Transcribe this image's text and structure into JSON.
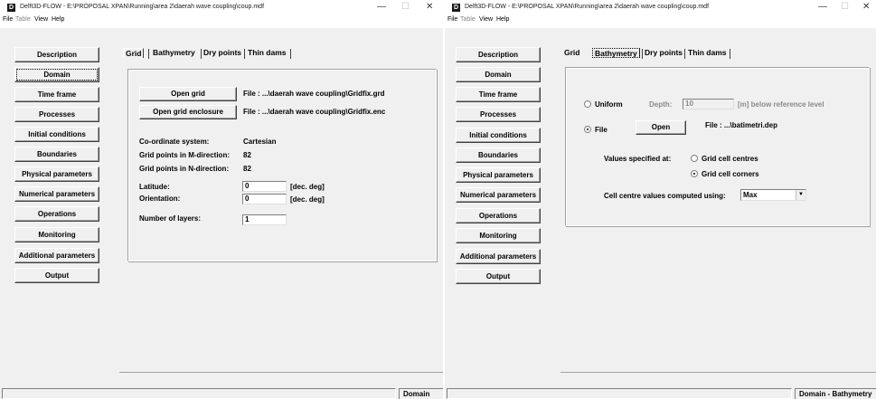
{
  "left": {
    "title": "Delft3D-FLOW - E:\\PROPOSAL XPAN\\Running\\area 2\\daerah wave coupling\\coup.mdf",
    "menu": [
      "File",
      "Table",
      "View",
      "Help"
    ],
    "nav": [
      "Description",
      "Domain",
      "Time frame",
      "Processes",
      "Initial conditions",
      "Boundaries",
      "Physical parameters",
      "Numerical parameters",
      "Operations",
      "Monitoring",
      "Additional parameters",
      "Output"
    ],
    "tabs": [
      "Grid",
      "Bathymetry",
      "Dry points",
      "Thin dams"
    ],
    "open_grid_label": "Open grid",
    "grid_file_text": "File : ...\\daerah wave coupling\\Gridfix.grd",
    "open_enclosure_label": "Open grid enclosure",
    "enclosure_file_text": "File : ...\\daerah wave coupling\\Gridfix.enc",
    "coord_label": "Co-ordinate system:",
    "coord_value": "Cartesian",
    "m_label": "Grid points in M-direction:",
    "m_value": "82",
    "n_label": "Grid points in N-direction:",
    "n_value": "82",
    "latitude_label": "Latitude:",
    "latitude_value": "0",
    "latitude_unit": "[dec. deg]",
    "orientation_label": "Orientation:",
    "orientation_value": "0",
    "orientation_unit": "[dec. deg]",
    "layers_label": "Number of layers:",
    "layers_value": "1",
    "status": "Domain"
  },
  "right": {
    "title": "Delft3D-FLOW - E:\\PROPOSAL XPAN\\Running\\area 2\\daerah wave coupling\\coup.mdf",
    "menu": [
      "File",
      "Table",
      "View",
      "Help"
    ],
    "nav": [
      "Description",
      "Domain",
      "Time frame",
      "Processes",
      "Initial conditions",
      "Boundaries",
      "Physical parameters",
      "Numerical parameters",
      "Operations",
      "Monitoring",
      "Additional parameters",
      "Output"
    ],
    "tabs": [
      "Grid",
      "Bathymetry",
      "Dry points",
      "Thin dams"
    ],
    "uniform_label": "Uniform",
    "depth_label": "Depth:",
    "depth_value": "10",
    "depth_unit": "[m] below reference level",
    "file_label": "File",
    "open_label": "Open",
    "file_text": "File : ...\\batimetri.dep",
    "values_label": "Values specified at:",
    "opt_centres": "Grid cell centres",
    "opt_corners": "Grid cell corners",
    "computed_label": "Cell centre values computed using:",
    "computed_value": "Max",
    "status": "Domain - Bathymetry"
  }
}
